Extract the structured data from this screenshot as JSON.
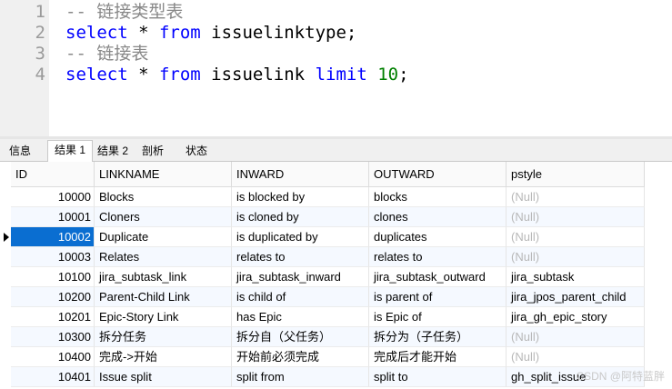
{
  "editor": {
    "lines": [
      {
        "num": "1",
        "comment": "-- 链接类型表"
      },
      {
        "num": "2",
        "kw1": "select",
        "star": " * ",
        "kw2": "from",
        "rest": " issuelinktype;"
      },
      {
        "num": "3",
        "comment": "-- 链接表"
      },
      {
        "num": "4",
        "kw1": "select",
        "star": " * ",
        "kw2": "from",
        "rest": " issuelink ",
        "kw3": "limit",
        "num_lit": " 10",
        "end": ";"
      }
    ]
  },
  "tabs": [
    "信息",
    "结果 1",
    "结果 2",
    "剖析",
    "状态"
  ],
  "active_tab": "结果 1",
  "grid": {
    "columns": [
      "ID",
      "LINKNAME",
      "INWARD",
      "OUTWARD",
      "pstyle"
    ],
    "rows": [
      [
        "10000",
        "Blocks",
        "is blocked by",
        "blocks",
        "(Null)"
      ],
      [
        "10001",
        "Cloners",
        "is cloned by",
        "clones",
        "(Null)"
      ],
      [
        "10002",
        "Duplicate",
        "is duplicated by",
        "duplicates",
        "(Null)"
      ],
      [
        "10003",
        "Relates",
        "relates to",
        "relates to",
        "(Null)"
      ],
      [
        "10100",
        "jira_subtask_link",
        "jira_subtask_inward",
        "jira_subtask_outward",
        "jira_subtask"
      ],
      [
        "10200",
        "Parent-Child Link",
        "is child of",
        "is parent of",
        "jira_jpos_parent_child"
      ],
      [
        "10201",
        "Epic-Story Link",
        "has Epic",
        "is Epic of",
        "jira_gh_epic_story"
      ],
      [
        "10300",
        "拆分任务",
        "拆分自（父任务）",
        "拆分为（子任务）",
        "(Null)"
      ],
      [
        "10400",
        "完成->开始",
        "开始前必须完成",
        "完成后才能开始",
        "(Null)"
      ],
      [
        "10401",
        "Issue split",
        "split from",
        "split to",
        "gh_split_issue"
      ]
    ],
    "selected_row": 2
  },
  "watermark": "CSDN @阿特蓝胖"
}
